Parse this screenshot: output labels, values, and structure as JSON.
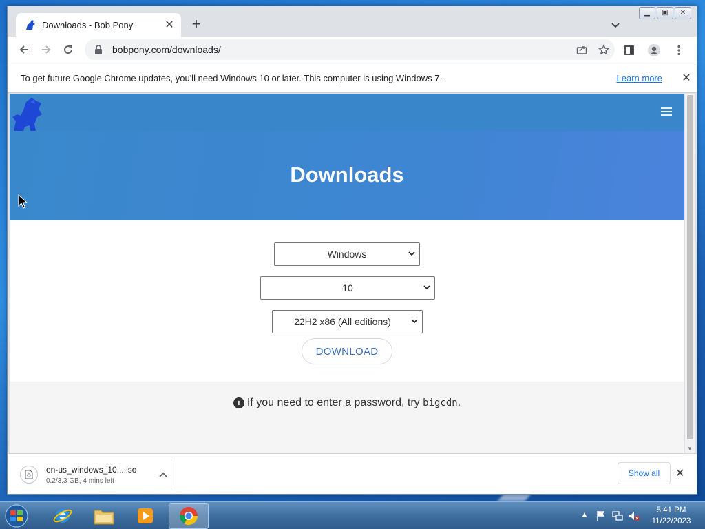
{
  "browser": {
    "tab_title": "Downloads - Bob Pony",
    "url": "bobpony.com/downloads/",
    "infobar_message": "To get future Google Chrome updates, you'll need Windows 10 or later. This computer is using Windows 7.",
    "infobar_link": "Learn more"
  },
  "page": {
    "heading": "Downloads",
    "os_select": "Windows",
    "version_select": "10",
    "edition_select": "22H2 x86 (All editions)",
    "download_label": "DOWNLOAD",
    "note_text": "If you need to enter a password, try ",
    "note_code": "bigcdn",
    "note_end": ".",
    "info_glyph": "i"
  },
  "download_shelf": {
    "file_name": "en-us_windows_10....iso",
    "status": "0.2/3.3 GB, 4 mins left",
    "show_all": "Show all"
  },
  "taskbar": {
    "time": "5:41 PM",
    "date": "11/22/2023"
  },
  "colors": {
    "hero": "#3e85d2",
    "accent_link": "#1a73e8",
    "download_text": "#3b6db4"
  }
}
